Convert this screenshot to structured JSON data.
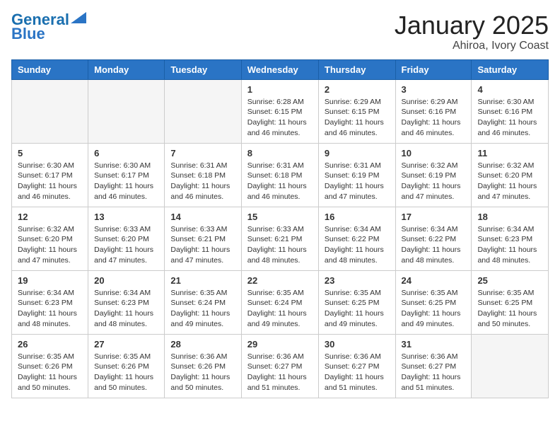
{
  "logo": {
    "line1": "General",
    "line2": "Blue"
  },
  "header": {
    "month": "January 2025",
    "location": "Ahiroa, Ivory Coast"
  },
  "weekdays": [
    "Sunday",
    "Monday",
    "Tuesday",
    "Wednesday",
    "Thursday",
    "Friday",
    "Saturday"
  ],
  "weeks": [
    [
      {
        "day": "",
        "info": ""
      },
      {
        "day": "",
        "info": ""
      },
      {
        "day": "",
        "info": ""
      },
      {
        "day": "1",
        "sunrise": "6:28 AM",
        "sunset": "6:15 PM",
        "daylight": "11 hours and 46 minutes."
      },
      {
        "day": "2",
        "sunrise": "6:29 AM",
        "sunset": "6:15 PM",
        "daylight": "11 hours and 46 minutes."
      },
      {
        "day": "3",
        "sunrise": "6:29 AM",
        "sunset": "6:16 PM",
        "daylight": "11 hours and 46 minutes."
      },
      {
        "day": "4",
        "sunrise": "6:30 AM",
        "sunset": "6:16 PM",
        "daylight": "11 hours and 46 minutes."
      }
    ],
    [
      {
        "day": "5",
        "sunrise": "6:30 AM",
        "sunset": "6:17 PM",
        "daylight": "11 hours and 46 minutes."
      },
      {
        "day": "6",
        "sunrise": "6:30 AM",
        "sunset": "6:17 PM",
        "daylight": "11 hours and 46 minutes."
      },
      {
        "day": "7",
        "sunrise": "6:31 AM",
        "sunset": "6:18 PM",
        "daylight": "11 hours and 46 minutes."
      },
      {
        "day": "8",
        "sunrise": "6:31 AM",
        "sunset": "6:18 PM",
        "daylight": "11 hours and 46 minutes."
      },
      {
        "day": "9",
        "sunrise": "6:31 AM",
        "sunset": "6:19 PM",
        "daylight": "11 hours and 47 minutes."
      },
      {
        "day": "10",
        "sunrise": "6:32 AM",
        "sunset": "6:19 PM",
        "daylight": "11 hours and 47 minutes."
      },
      {
        "day": "11",
        "sunrise": "6:32 AM",
        "sunset": "6:20 PM",
        "daylight": "11 hours and 47 minutes."
      }
    ],
    [
      {
        "day": "12",
        "sunrise": "6:32 AM",
        "sunset": "6:20 PM",
        "daylight": "11 hours and 47 minutes."
      },
      {
        "day": "13",
        "sunrise": "6:33 AM",
        "sunset": "6:20 PM",
        "daylight": "11 hours and 47 minutes."
      },
      {
        "day": "14",
        "sunrise": "6:33 AM",
        "sunset": "6:21 PM",
        "daylight": "11 hours and 47 minutes."
      },
      {
        "day": "15",
        "sunrise": "6:33 AM",
        "sunset": "6:21 PM",
        "daylight": "11 hours and 48 minutes."
      },
      {
        "day": "16",
        "sunrise": "6:34 AM",
        "sunset": "6:22 PM",
        "daylight": "11 hours and 48 minutes."
      },
      {
        "day": "17",
        "sunrise": "6:34 AM",
        "sunset": "6:22 PM",
        "daylight": "11 hours and 48 minutes."
      },
      {
        "day": "18",
        "sunrise": "6:34 AM",
        "sunset": "6:23 PM",
        "daylight": "11 hours and 48 minutes."
      }
    ],
    [
      {
        "day": "19",
        "sunrise": "6:34 AM",
        "sunset": "6:23 PM",
        "daylight": "11 hours and 48 minutes."
      },
      {
        "day": "20",
        "sunrise": "6:34 AM",
        "sunset": "6:23 PM",
        "daylight": "11 hours and 48 minutes."
      },
      {
        "day": "21",
        "sunrise": "6:35 AM",
        "sunset": "6:24 PM",
        "daylight": "11 hours and 49 minutes."
      },
      {
        "day": "22",
        "sunrise": "6:35 AM",
        "sunset": "6:24 PM",
        "daylight": "11 hours and 49 minutes."
      },
      {
        "day": "23",
        "sunrise": "6:35 AM",
        "sunset": "6:25 PM",
        "daylight": "11 hours and 49 minutes."
      },
      {
        "day": "24",
        "sunrise": "6:35 AM",
        "sunset": "6:25 PM",
        "daylight": "11 hours and 49 minutes."
      },
      {
        "day": "25",
        "sunrise": "6:35 AM",
        "sunset": "6:25 PM",
        "daylight": "11 hours and 50 minutes."
      }
    ],
    [
      {
        "day": "26",
        "sunrise": "6:35 AM",
        "sunset": "6:26 PM",
        "daylight": "11 hours and 50 minutes."
      },
      {
        "day": "27",
        "sunrise": "6:35 AM",
        "sunset": "6:26 PM",
        "daylight": "11 hours and 50 minutes."
      },
      {
        "day": "28",
        "sunrise": "6:36 AM",
        "sunset": "6:26 PM",
        "daylight": "11 hours and 50 minutes."
      },
      {
        "day": "29",
        "sunrise": "6:36 AM",
        "sunset": "6:27 PM",
        "daylight": "11 hours and 51 minutes."
      },
      {
        "day": "30",
        "sunrise": "6:36 AM",
        "sunset": "6:27 PM",
        "daylight": "11 hours and 51 minutes."
      },
      {
        "day": "31",
        "sunrise": "6:36 AM",
        "sunset": "6:27 PM",
        "daylight": "11 hours and 51 minutes."
      },
      {
        "day": "",
        "info": ""
      }
    ]
  ]
}
